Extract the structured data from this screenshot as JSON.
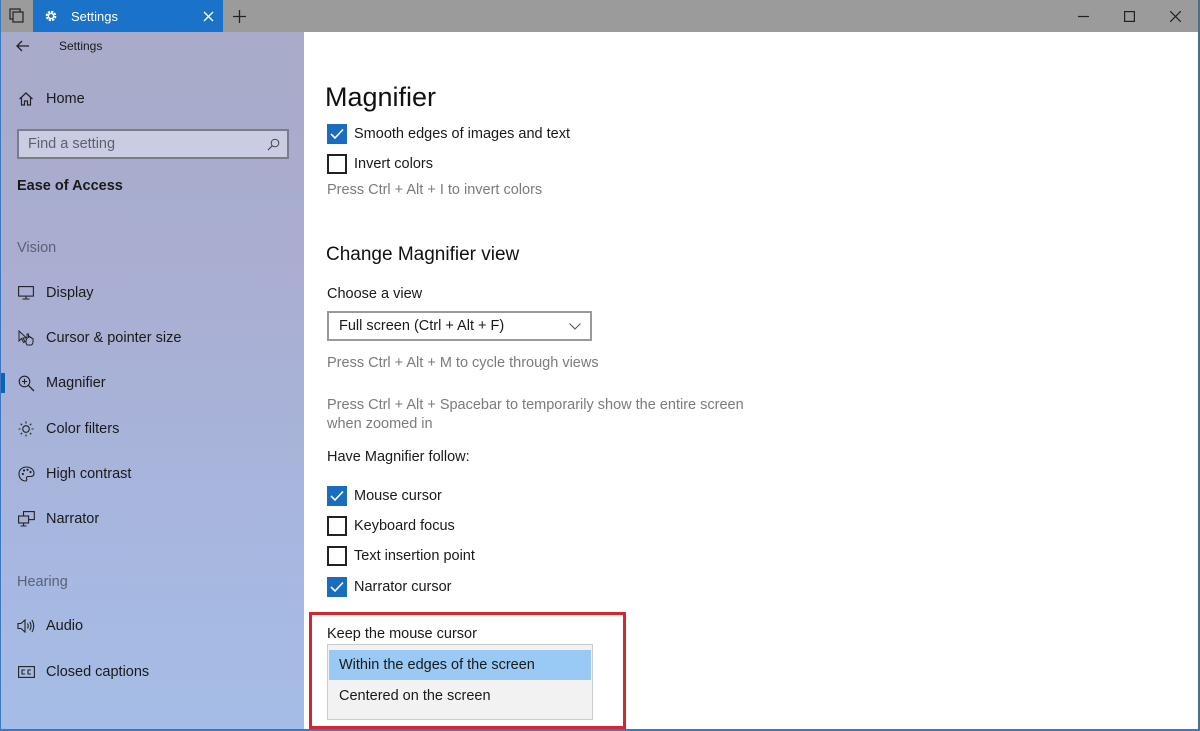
{
  "window": {
    "tab_title": "Settings",
    "icons": {
      "task_view": "task-view-icon",
      "tab": "gear-icon",
      "tab_close": "close-icon",
      "new_tab": "plus-icon",
      "minimize": "minimize-icon",
      "maximize": "maximize-icon",
      "close": "close-icon"
    }
  },
  "sidebar": {
    "app_title": "Settings",
    "home_label": "Home",
    "search_placeholder": "Find a setting",
    "category": "Ease of Access",
    "sections": [
      {
        "title": "Vision",
        "items": [
          {
            "label": "Display",
            "icon": "monitor-icon"
          },
          {
            "label": "Cursor & pointer size",
            "icon": "pointer-icon"
          },
          {
            "label": "Magnifier",
            "icon": "magnifier-icon",
            "selected": true
          },
          {
            "label": "Color filters",
            "icon": "sun-icon"
          },
          {
            "label": "High contrast",
            "icon": "palette-icon"
          },
          {
            "label": "Narrator",
            "icon": "narrator-icon"
          }
        ]
      },
      {
        "title": "Hearing",
        "items": [
          {
            "label": "Audio",
            "icon": "speaker-icon"
          },
          {
            "label": "Closed captions",
            "icon": "cc-icon"
          }
        ]
      }
    ]
  },
  "main": {
    "page_title": "Magnifier",
    "top_options": [
      {
        "label": "Smooth edges of images and text",
        "checked": true
      },
      {
        "label": "Invert colors",
        "checked": false
      }
    ],
    "invert_hint": "Press Ctrl + Alt + I to invert colors",
    "view_section_title": "Change Magnifier view",
    "choose_view_label": "Choose a view",
    "view_selected": "Full screen (Ctrl + Alt + F)",
    "cycle_hint": "Press Ctrl + Alt + M to cycle through views",
    "spacebar_hint_line1": "Press Ctrl + Alt + Spacebar to temporarily show the entire screen",
    "spacebar_hint_line2": "when zoomed in",
    "follow_label": "Have Magnifier follow:",
    "follow_options": [
      {
        "label": "Mouse cursor",
        "checked": true
      },
      {
        "label": "Keyboard focus",
        "checked": false
      },
      {
        "label": "Text insertion point",
        "checked": false
      },
      {
        "label": "Narrator cursor",
        "checked": true
      }
    ],
    "keep_cursor_label": "Keep the mouse cursor",
    "keep_cursor_options": [
      {
        "label": "Within the edges of the screen",
        "selected": true
      },
      {
        "label": "Centered on the screen",
        "selected": false
      }
    ]
  },
  "colors": {
    "accent": "#1a6cbf",
    "tab_active": "#1a73c8",
    "highlight_annotation": "#d3262f",
    "dropdown_selected": "#99c9f5"
  }
}
